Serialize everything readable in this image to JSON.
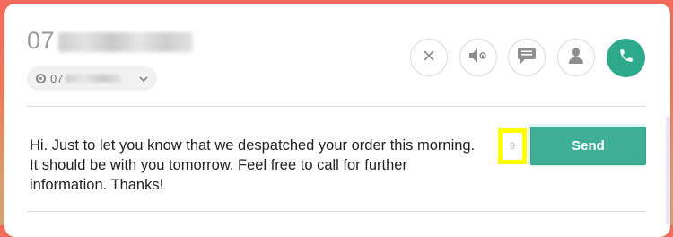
{
  "header": {
    "phone_number_visible": "07",
    "line_select": {
      "value_visible": "07"
    }
  },
  "actions": {
    "close_icon": "close-icon",
    "mute_icon": "speaker-mute-icon",
    "chat_icon": "chat-icon",
    "contact_icon": "person-icon",
    "call_icon": "phone-icon"
  },
  "message": {
    "text": "Hi. Just to let you know that we despatched your order this morning. It should be with you tomorrow. Feel free to call for further information. Thanks!",
    "counter": "9",
    "send_label": "Send"
  },
  "colors": {
    "accent": "#2ea98c",
    "highlight": "#ffff00",
    "background_top": "#f26a5b"
  }
}
